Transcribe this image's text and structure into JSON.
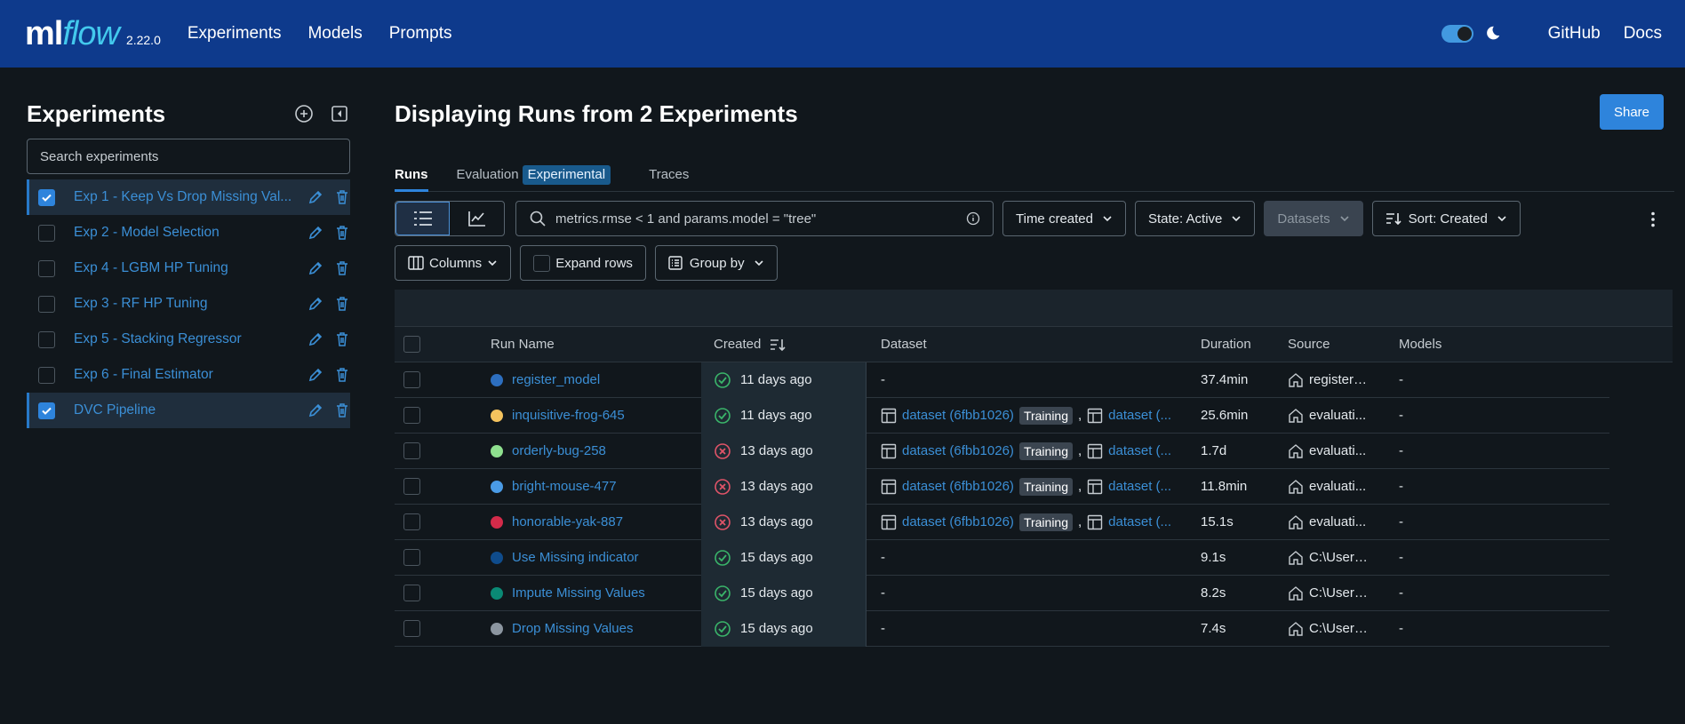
{
  "header": {
    "logo_ml": "ml",
    "logo_flow": "flow",
    "version": "2.22.0",
    "nav": [
      "Experiments",
      "Models",
      "Prompts"
    ],
    "links": [
      "GitHub",
      "Docs"
    ],
    "bg_color": "#0e3a8c"
  },
  "sidebar": {
    "title": "Experiments",
    "search_placeholder": "Search experiments",
    "experiments": [
      {
        "name": "Exp 1 - Keep Vs Drop Missing Val...",
        "checked": true
      },
      {
        "name": "Exp 2 - Model Selection",
        "checked": false
      },
      {
        "name": "Exp 4 - LGBM HP Tuning",
        "checked": false
      },
      {
        "name": "Exp 3 - RF HP Tuning",
        "checked": false
      },
      {
        "name": "Exp 5 - Stacking Regressor",
        "checked": false
      },
      {
        "name": "Exp 6 - Final Estimator",
        "checked": false
      },
      {
        "name": "DVC Pipeline",
        "checked": true
      }
    ]
  },
  "main": {
    "title": "Displaying Runs from 2 Experiments",
    "share_label": "Share",
    "tabs": {
      "runs": "Runs",
      "evaluation": "Evaluation",
      "experimental": "Experimental",
      "traces": "Traces"
    },
    "search_query": "metrics.rmse < 1 and params.model = \"tree\"",
    "filters": {
      "time": "Time created",
      "state": "State: Active",
      "datasets": "Datasets",
      "sort": "Sort: Created"
    },
    "toolbar2": {
      "columns": "Columns",
      "expand": "Expand rows",
      "group": "Group by"
    }
  },
  "table": {
    "headers": {
      "name": "Run Name",
      "created": "Created",
      "dataset": "Dataset",
      "duration": "Duration",
      "source": "Source",
      "models": "Models"
    },
    "rows": [
      {
        "name": "register_model",
        "color": "#2d6fc0",
        "status": "ok",
        "created": "11 days ago",
        "dataset": null,
        "duration": "37.4min",
        "source": "register_...",
        "models": "-"
      },
      {
        "name": "inquisitive-frog-645",
        "color": "#f5c35e",
        "status": "ok",
        "created": "11 days ago",
        "dataset": {
          "name": "dataset (6fbb1026)",
          "tag": "Training",
          "more": "dataset (..."
        },
        "duration": "25.6min",
        "source": "evaluati...",
        "models": "-"
      },
      {
        "name": "orderly-bug-258",
        "color": "#8fe08f",
        "status": "fail",
        "created": "13 days ago",
        "dataset": {
          "name": "dataset (6fbb1026)",
          "tag": "Training",
          "more": "dataset (..."
        },
        "duration": "1.7d",
        "source": "evaluati...",
        "models": "-"
      },
      {
        "name": "bright-mouse-477",
        "color": "#4a9be6",
        "status": "fail",
        "created": "13 days ago",
        "dataset": {
          "name": "dataset (6fbb1026)",
          "tag": "Training",
          "more": "dataset (..."
        },
        "duration": "11.8min",
        "source": "evaluati...",
        "models": "-"
      },
      {
        "name": "honorable-yak-887",
        "color": "#d42b4a",
        "status": "fail",
        "created": "13 days ago",
        "dataset": {
          "name": "dataset (6fbb1026)",
          "tag": "Training",
          "more": "dataset (..."
        },
        "duration": "15.1s",
        "source": "evaluati...",
        "models": "-"
      },
      {
        "name": "Use Missing indicator",
        "color": "#0f4c8c",
        "status": "ok",
        "created": "15 days ago",
        "dataset": null,
        "duration": "9.1s",
        "source": "C:\\Users....",
        "models": "-"
      },
      {
        "name": "Impute Missing Values",
        "color": "#0a8a75",
        "status": "ok",
        "created": "15 days ago",
        "dataset": null,
        "duration": "8.2s",
        "source": "C:\\Users....",
        "models": "-"
      },
      {
        "name": "Drop Missing Values",
        "color": "#8c96a0",
        "status": "ok",
        "created": "15 days ago",
        "dataset": null,
        "duration": "7.4s",
        "source": "C:\\Users....",
        "models": "-"
      }
    ],
    "empty_dataset": "-"
  }
}
